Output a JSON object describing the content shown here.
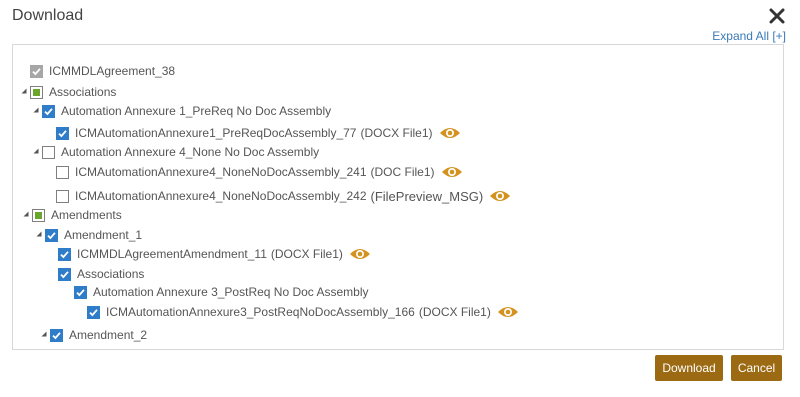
{
  "dialog": {
    "title": "Download",
    "expand_all": "Expand All [+]"
  },
  "colors": {
    "accent": "#2f7cc9",
    "button": "#9b6a12",
    "eye": "#d4921f",
    "partial": "#6aa52c"
  },
  "tree": [
    {
      "label": "ICMMDLAgreement_38",
      "state": "checked-disabled"
    },
    {
      "label": "Associations",
      "state": "partial",
      "expanded": true
    },
    {
      "label": "Automation Annexure 1_PreReq No Doc Assembly",
      "state": "checked",
      "expanded": true
    },
    {
      "label": "ICMAutomationAnnexure1_PreReqDocAssembly_77",
      "suffix": "(DOCX File1)",
      "state": "checked",
      "icon": "eye-icon"
    },
    {
      "label": "Automation Annexure 4_None No Doc Assembly",
      "state": "unchecked",
      "expanded": true
    },
    {
      "label": "ICMAutomationAnnexure4_NoneNoDocAssembly_241",
      "suffix": "(DOC File1)",
      "state": "unchecked",
      "icon": "eye-icon"
    },
    {
      "label": "ICMAutomationAnnexure4_NoneNoDocAssembly_242",
      "suffix": "(FilePreview_MSG)",
      "state": "unchecked",
      "icon": "eye-icon"
    },
    {
      "label": "Amendments",
      "state": "partial",
      "expanded": true
    },
    {
      "label": "Amendment_1",
      "state": "checked",
      "expanded": true
    },
    {
      "label": "ICMMDLAgreementAmendment_11",
      "suffix": "(DOCX File1)",
      "state": "checked",
      "icon": "eye-icon"
    },
    {
      "label": "Associations",
      "state": "checked"
    },
    {
      "label": "Automation Annexure 3_PostReq No Doc Assembly",
      "state": "checked"
    },
    {
      "label": "ICMAutomationAnnexure3_PostReqNoDocAssembly_166",
      "suffix": "(DOCX File1)",
      "state": "checked",
      "icon": "eye-icon"
    },
    {
      "label": "Amendment_2",
      "state": "checked",
      "expanded": true
    }
  ],
  "buttons": {
    "download": "Download",
    "cancel": "Cancel"
  }
}
